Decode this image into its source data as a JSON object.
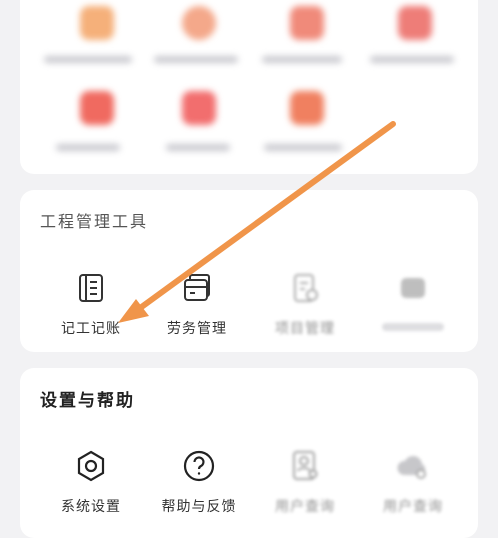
{
  "top_grid": {
    "row1_colors": [
      "#f5b07a",
      "#f4a88a",
      "#f08a7a",
      "#ee7d78"
    ],
    "row2_colors": [
      "#f06a60",
      "#f26e6e",
      "#f08060"
    ]
  },
  "engineering": {
    "title": "工程管理工具",
    "items": [
      {
        "label": "记工记账",
        "icon": "ledger-icon"
      },
      {
        "label": "劳务管理",
        "icon": "labor-management-icon"
      },
      {
        "label": "项目管理",
        "icon": "project-management-icon"
      },
      {
        "label": "",
        "icon": "blurred-tool-icon"
      }
    ]
  },
  "settings": {
    "title": "设置与帮助",
    "items": [
      {
        "label": "系统设置",
        "icon": "hexagon-settings-icon"
      },
      {
        "label": "帮助与反馈",
        "icon": "question-circle-icon"
      },
      {
        "label": "用户查询",
        "icon": "user-search-icon"
      },
      {
        "label": "用户查询",
        "icon": "cloud-search-icon"
      }
    ]
  },
  "annotation": {
    "arrow_color": "#f0954a"
  }
}
